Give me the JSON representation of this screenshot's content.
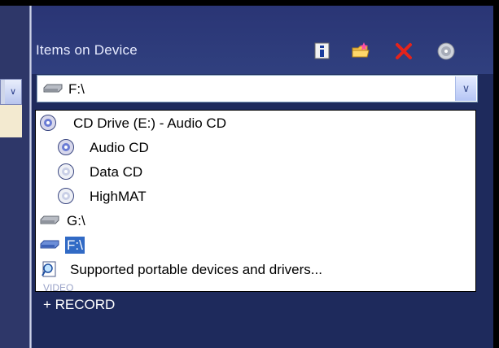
{
  "header": {
    "title": "Items on Device",
    "icons": [
      "info-icon",
      "folder-add-icon",
      "delete-icon",
      "disc-icon"
    ]
  },
  "combo": {
    "selected": "F:\\",
    "icon": "drive-icon"
  },
  "dropdown": {
    "items": [
      {
        "label": "CD Drive (E:) - Audio CD",
        "icon": "cd-icon",
        "level": 0
      },
      {
        "label": "Audio CD",
        "icon": "cd-icon",
        "level": 1
      },
      {
        "label": "Data CD",
        "icon": "cd-icon",
        "level": 1
      },
      {
        "label": "HighMAT",
        "icon": "cd-icon",
        "level": 1
      },
      {
        "label": "G:\\",
        "icon": "drive-icon",
        "level": 0
      },
      {
        "label": "F:\\",
        "icon": "drive-icon",
        "level": 0,
        "selected": true
      },
      {
        "label": "Supported portable devices and drivers...",
        "icon": "magnifier-page-icon",
        "level": 0
      }
    ]
  },
  "below": {
    "partial": "VIDEO",
    "record": "+ RECORD"
  },
  "colors": {
    "panel": "#1e2a5c",
    "selection": "#316ac5"
  }
}
